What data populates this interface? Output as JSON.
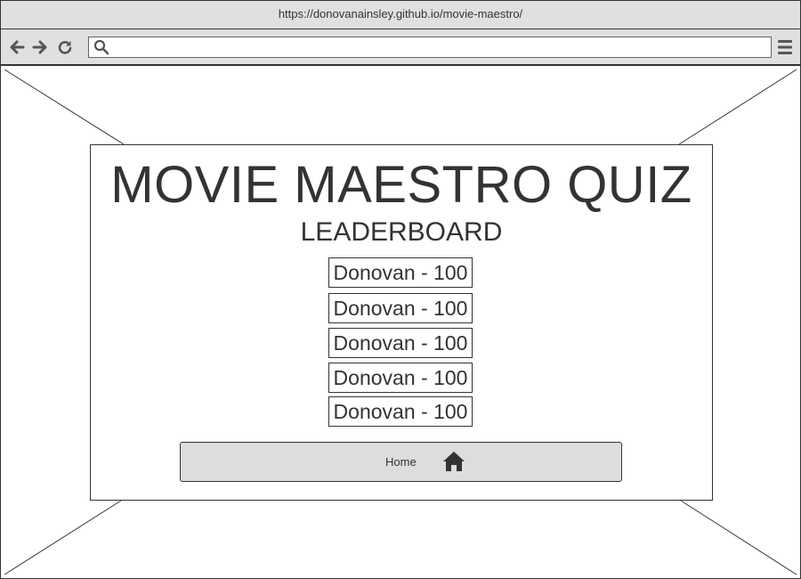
{
  "browser": {
    "url": "https://donovanainsley.github.io/movie-maestro/",
    "address_value": "",
    "icons": {
      "back": "arrow-left-icon",
      "forward": "arrow-right-icon",
      "reload": "reload-icon",
      "search": "search-icon",
      "menu": "hamburger-menu-icon"
    }
  },
  "page": {
    "title": "MOVIE MAESTRO QUIZ",
    "subtitle": "LEADERBOARD",
    "scores": [
      "Donovan - 100",
      "Donovan - 100",
      "Donovan - 100",
      "Donovan - 100",
      "Donovan - 100"
    ],
    "home_button": {
      "label": "Home",
      "icon": "home-icon"
    }
  },
  "colors": {
    "chrome": "#e0e0e0",
    "stroke": "#333333",
    "button_fill": "#dddddd",
    "background": "#ffffff"
  }
}
